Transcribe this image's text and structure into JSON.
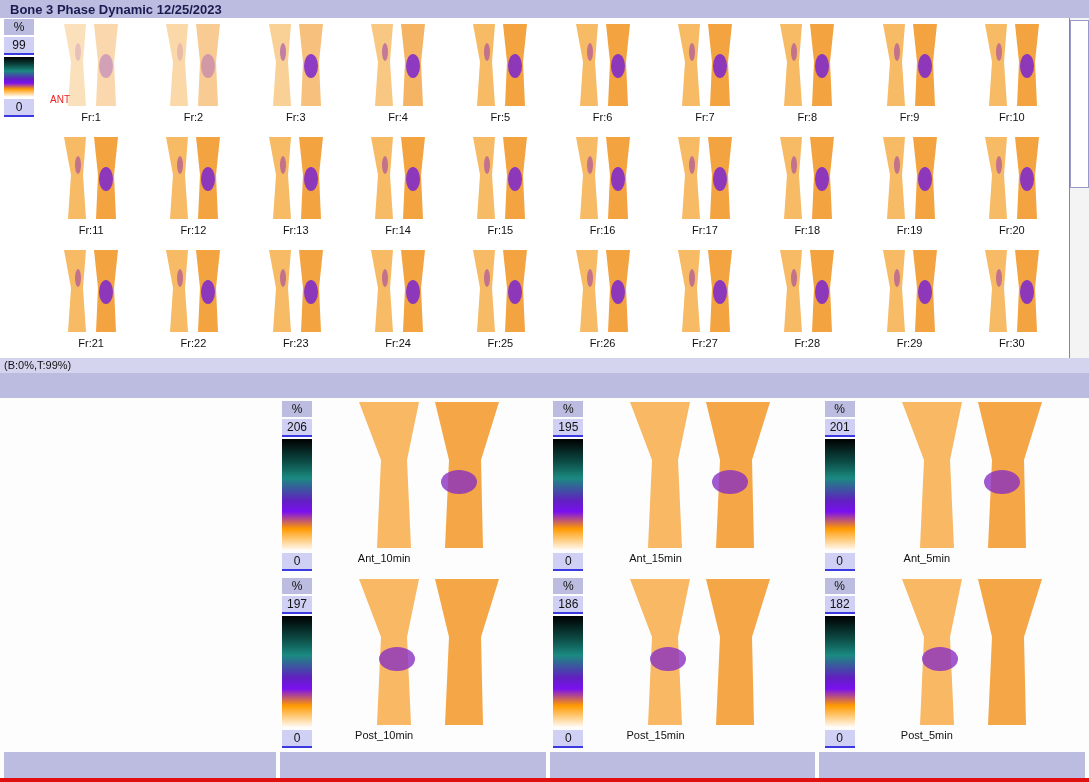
{
  "title": "Bone 3 Phase Dynamic 12/25/2023",
  "dynamic": {
    "scale": {
      "unit": "%",
      "max": "99",
      "min": "0"
    },
    "orientation_label": "ANT",
    "frames": [
      "Fr:1",
      "Fr:2",
      "Fr:3",
      "Fr:4",
      "Fr:5",
      "Fr:6",
      "Fr:7",
      "Fr:8",
      "Fr:9",
      "Fr:10",
      "Fr:11",
      "Fr:12",
      "Fr:13",
      "Fr:14",
      "Fr:15",
      "Fr:16",
      "Fr:17",
      "Fr:18",
      "Fr:19",
      "Fr:20",
      "Fr:21",
      "Fr:22",
      "Fr:23",
      "Fr:24",
      "Fr:25",
      "Fr:26",
      "Fr:27",
      "Fr:28",
      "Fr:29",
      "Fr:30"
    ]
  },
  "status": "(B:0%,T:99%)",
  "static_images": [
    {
      "kind": "ant",
      "unit": "%",
      "max": "206",
      "min": "0",
      "label": "Ant_10min"
    },
    {
      "kind": "ant",
      "unit": "%",
      "max": "195",
      "min": "0",
      "label": "Ant_15min"
    },
    {
      "kind": "ant",
      "unit": "%",
      "max": "201",
      "min": "0",
      "label": "Ant_5min"
    },
    {
      "kind": "post",
      "unit": "%",
      "max": "197",
      "min": "0",
      "label": "Post_10min"
    },
    {
      "kind": "post",
      "unit": "%",
      "max": "186",
      "min": "0",
      "label": "Post_15min"
    },
    {
      "kind": "post",
      "unit": "%",
      "max": "182",
      "min": "0",
      "label": "Post_5min"
    }
  ]
}
